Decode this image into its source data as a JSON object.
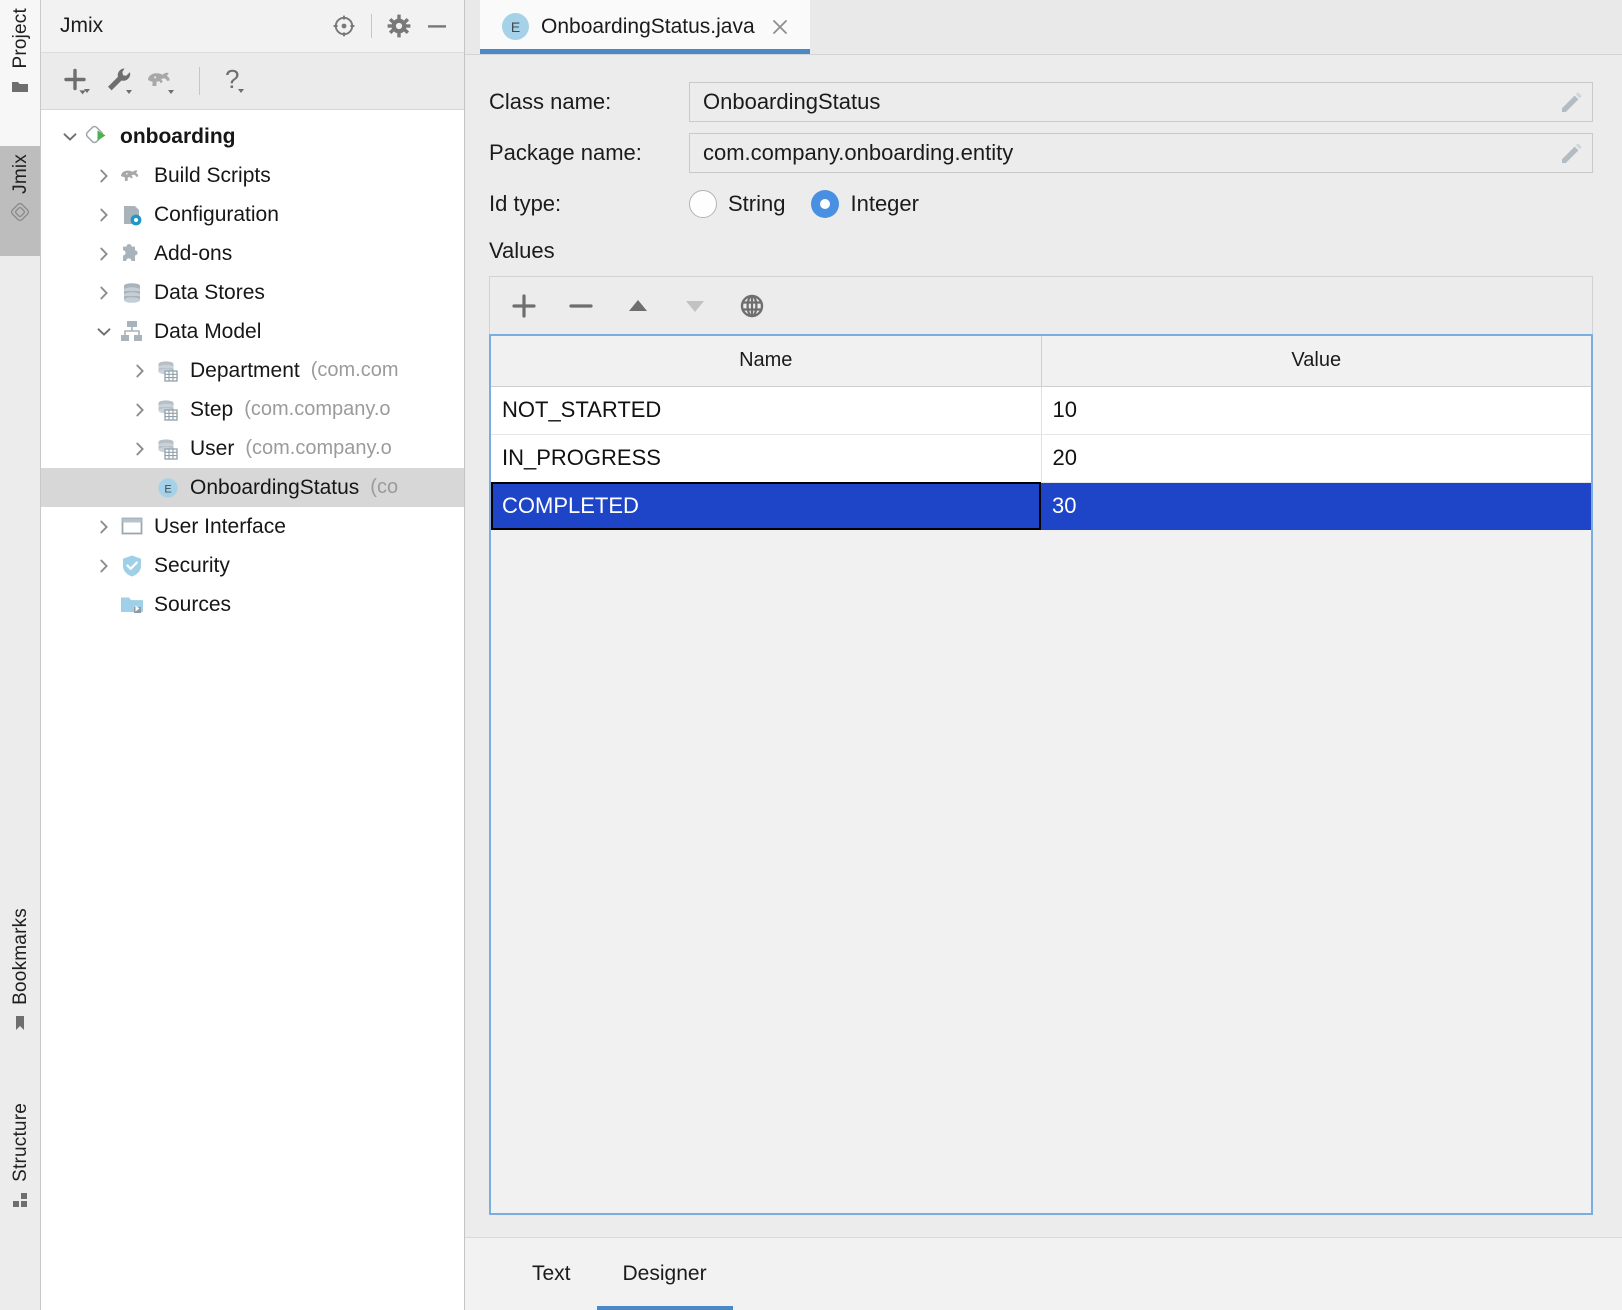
{
  "toolstrip": {
    "buttons": [
      {
        "label": "Project",
        "icon": "project-folder-icon",
        "state": "active"
      },
      {
        "label": "Jmix",
        "icon": "jmix-diamond-icon",
        "state": "selected"
      },
      {
        "label": "Bookmarks",
        "icon": "bookmark-icon",
        "state": "normal"
      },
      {
        "label": "Structure",
        "icon": "structure-icon",
        "state": "normal"
      }
    ]
  },
  "project_panel": {
    "title": "Jmix",
    "header_actions": [
      {
        "name": "locate-icon",
        "tooltip": "Select Opened File"
      },
      {
        "name": "gear-icon",
        "tooltip": "Options"
      },
      {
        "name": "minimize-icon",
        "tooltip": "Hide"
      }
    ],
    "toolbar_actions": [
      {
        "name": "add-icon",
        "label": "New"
      },
      {
        "name": "wrench-icon",
        "label": "Tools"
      },
      {
        "name": "gradle-elephant-icon",
        "label": "Gradle"
      },
      {
        "name": "help-question-icon",
        "label": "Help"
      }
    ],
    "tree": [
      {
        "label": "onboarding",
        "package": "",
        "indent": 0,
        "twist": "expanded",
        "icon": "jmix-project-run-icon",
        "bold": true,
        "selected": false
      },
      {
        "label": "Build Scripts",
        "package": "",
        "indent": 1,
        "twist": "collapsed",
        "icon": "gradle-elephant-icon",
        "bold": false,
        "selected": false
      },
      {
        "label": "Configuration",
        "package": "",
        "indent": 1,
        "twist": "collapsed",
        "icon": "configuration-icon",
        "bold": false,
        "selected": false
      },
      {
        "label": "Add-ons",
        "package": "",
        "indent": 1,
        "twist": "collapsed",
        "icon": "addons-puzzle-icon",
        "bold": false,
        "selected": false
      },
      {
        "label": "Data Stores",
        "package": "",
        "indent": 1,
        "twist": "collapsed",
        "icon": "datastore-icon",
        "bold": false,
        "selected": false
      },
      {
        "label": "Data Model",
        "package": "",
        "indent": 1,
        "twist": "expanded",
        "icon": "data-model-icon",
        "bold": false,
        "selected": false
      },
      {
        "label": "Department",
        "package": "(com.com",
        "indent": 2,
        "twist": "collapsed",
        "icon": "entity-icon",
        "bold": false,
        "selected": false
      },
      {
        "label": "Step",
        "package": "(com.company.o",
        "indent": 2,
        "twist": "collapsed",
        "icon": "entity-icon",
        "bold": false,
        "selected": false
      },
      {
        "label": "User",
        "package": "(com.company.o",
        "indent": 2,
        "twist": "collapsed",
        "icon": "entity-icon",
        "bold": false,
        "selected": false
      },
      {
        "label": "OnboardingStatus",
        "package": "(co",
        "indent": 2,
        "twist": "none",
        "icon": "enum-e-icon",
        "bold": false,
        "selected": true
      },
      {
        "label": "User Interface",
        "package": "",
        "indent": 1,
        "twist": "collapsed",
        "icon": "user-interface-icon",
        "bold": false,
        "selected": false
      },
      {
        "label": "Security",
        "package": "",
        "indent": 1,
        "twist": "collapsed",
        "icon": "security-shield-icon",
        "bold": false,
        "selected": false
      },
      {
        "label": "Sources",
        "package": "",
        "indent": 1,
        "twist": "none",
        "icon": "sources-folder-icon",
        "bold": false,
        "selected": false
      }
    ]
  },
  "editor": {
    "tab": {
      "badge": "E",
      "title": "OnboardingStatus.java",
      "close_icon": "close-icon",
      "active": true
    },
    "designer": {
      "class_name_label": "Class name:",
      "class_name_value": "OnboardingStatus",
      "package_name_label": "Package name:",
      "package_name_value": "com.company.onboarding.entity",
      "id_type_label": "Id type:",
      "id_type_options": [
        {
          "label": "String",
          "selected": false
        },
        {
          "label": "Integer",
          "selected": true
        }
      ],
      "values_caption": "Values",
      "values_toolbar": [
        {
          "name": "add-value-icon",
          "glyph": "+",
          "enabled": true
        },
        {
          "name": "remove-value-icon",
          "glyph": "−",
          "enabled": true
        },
        {
          "name": "move-up-icon",
          "glyph": "▲",
          "enabled": true
        },
        {
          "name": "move-down-icon",
          "glyph": "▼",
          "enabled": false
        },
        {
          "name": "localization-globe-icon",
          "glyph": "globe",
          "enabled": true
        }
      ],
      "table": {
        "columns": [
          "Name",
          "Value"
        ],
        "rows": [
          {
            "name": "NOT_STARTED",
            "value": "10",
            "selected": false
          },
          {
            "name": "IN_PROGRESS",
            "value": "20",
            "selected": false
          },
          {
            "name": "COMPLETED",
            "value": "30",
            "selected": true
          }
        ]
      }
    },
    "bottom_tabs": [
      {
        "label": "Text",
        "active": false
      },
      {
        "label": "Designer",
        "active": true
      }
    ]
  },
  "colors": {
    "accent_blue": "#4a88c7",
    "selection_blue": "#1e44c8",
    "radio_blue": "#4a90e2",
    "panel_bg": "#ececec",
    "tree_selected": "#d7d7d7",
    "focus_border": "#7aaee0"
  }
}
